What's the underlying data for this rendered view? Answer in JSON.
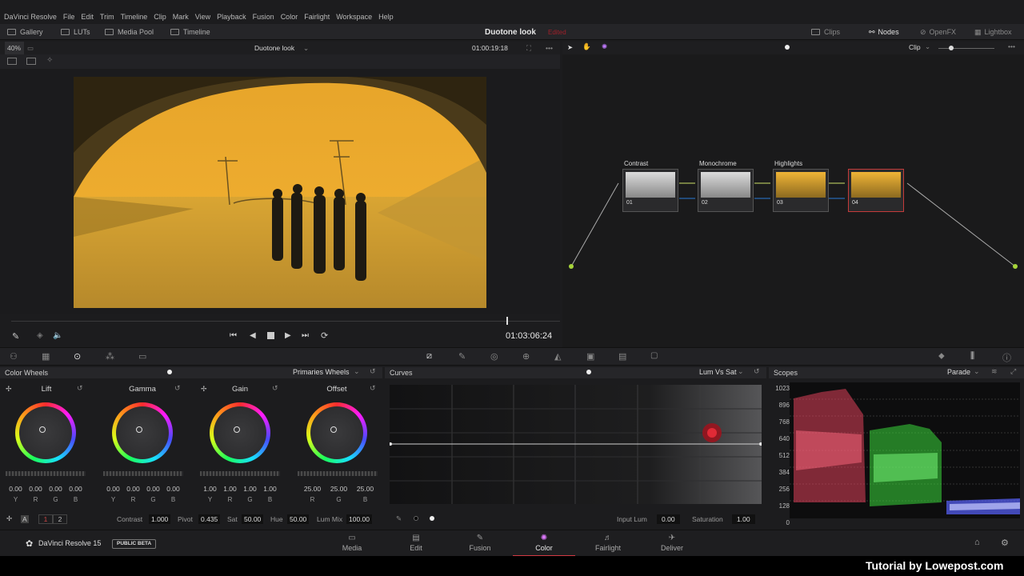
{
  "menu": [
    "DaVinci Resolve",
    "File",
    "Edit",
    "Trim",
    "Timeline",
    "Clip",
    "Mark",
    "View",
    "Playback",
    "Fusion",
    "Color",
    "Fairlight",
    "Workspace",
    "Help"
  ],
  "toolbar": {
    "gallery": "Gallery",
    "luts": "LUTs",
    "media_pool": "Media Pool",
    "timeline": "Timeline",
    "project_title": "Duotone look",
    "edited": "Edited",
    "clips": "Clips",
    "nodes": "Nodes",
    "openfx": "OpenFX",
    "lightbox": "Lightbox"
  },
  "viewer": {
    "zoom": "40%",
    "clip_name": "Duotone look",
    "timecode_top": "01:00:19:18",
    "timecode": "01:03:06:24"
  },
  "nodebar": {
    "mode": "Clip"
  },
  "nodes": [
    {
      "label": "Contrast",
      "num": "01"
    },
    {
      "label": "Monochrome",
      "num": "02"
    },
    {
      "label": "Highlights",
      "num": "03"
    },
    {
      "label": "",
      "num": "04"
    }
  ],
  "color_wheels": {
    "title": "Color Wheels",
    "mode": "Primaries Wheels",
    "wheels": [
      {
        "label": "Lift",
        "values": [
          "0.00",
          "0.00",
          "0.00",
          "0.00"
        ],
        "letters": [
          "Y",
          "R",
          "G",
          "B"
        ]
      },
      {
        "label": "Gamma",
        "values": [
          "0.00",
          "0.00",
          "0.00",
          "0.00"
        ],
        "letters": [
          "Y",
          "R",
          "G",
          "B"
        ]
      },
      {
        "label": "Gain",
        "values": [
          "1.00",
          "1.00",
          "1.00",
          "1.00"
        ],
        "letters": [
          "Y",
          "R",
          "G",
          "B"
        ]
      },
      {
        "label": "Offset",
        "values": [
          "25.00",
          "25.00",
          "25.00"
        ],
        "letters": [
          "R",
          "G",
          "B"
        ]
      }
    ],
    "footer": {
      "page1": "1",
      "page2": "2",
      "contrast_label": "Contrast",
      "contrast": "1.000",
      "pivot_label": "Pivot",
      "pivot": "0.435",
      "sat_label": "Sat",
      "sat": "50.00",
      "hue_label": "Hue",
      "hue": "50.00",
      "lummix_label": "Lum Mix",
      "lummix": "100.00"
    }
  },
  "curves": {
    "title": "Curves",
    "mode": "Lum Vs Sat",
    "input_lum_label": "Input Lum",
    "input_lum": "0.00",
    "saturation_label": "Saturation",
    "saturation": "1.00"
  },
  "scopes": {
    "title": "Scopes",
    "mode": "Parade",
    "ticks": [
      "1023",
      "896",
      "768",
      "640",
      "512",
      "384",
      "256",
      "128",
      "0"
    ]
  },
  "pages": [
    {
      "label": "Media",
      "glyph": "▭"
    },
    {
      "label": "Edit",
      "glyph": "▤"
    },
    {
      "label": "Fusion",
      "glyph": "✎"
    },
    {
      "label": "Color",
      "glyph": "✺"
    },
    {
      "label": "Fairlight",
      "glyph": "♬"
    },
    {
      "label": "Deliver",
      "glyph": "✈"
    }
  ],
  "footer": {
    "app": "DaVinci Resolve 15",
    "badge": "PUBLIC BETA"
  },
  "watermark": "Tutorial by Lowepost.com"
}
